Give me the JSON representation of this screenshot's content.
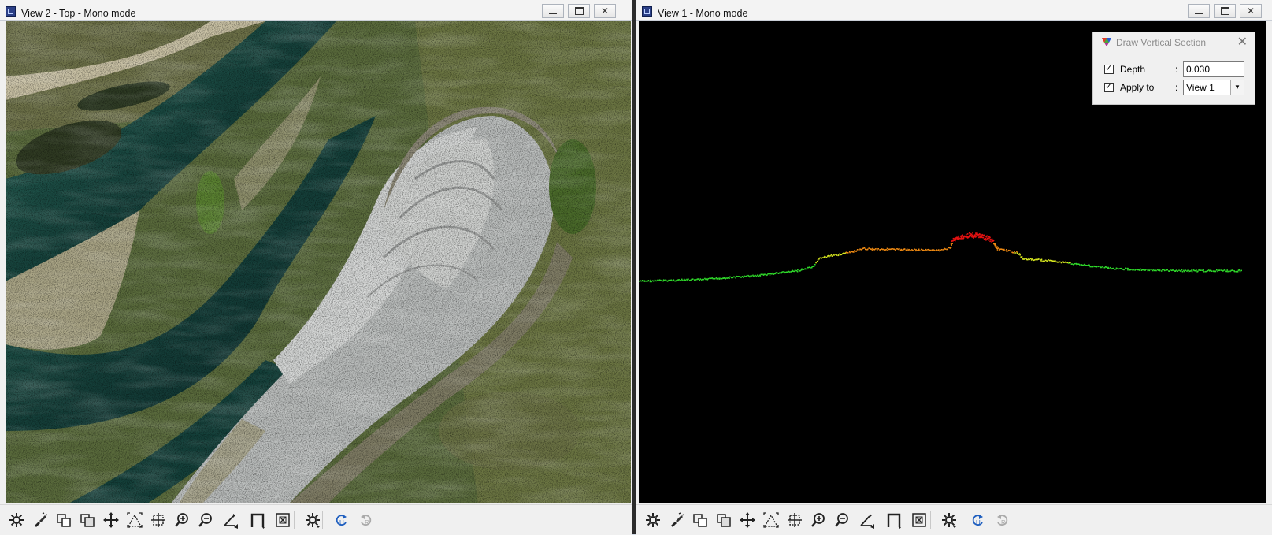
{
  "left_window": {
    "title": "View 2 - Top - Mono mode",
    "content": "aerial-orthophoto-point-cloud"
  },
  "right_window": {
    "title": "View 1 - Mono mode",
    "content": "vertical-section-profile"
  },
  "caption_buttons": {
    "minimize": "▭",
    "maximize": "⧉",
    "close": "✕"
  },
  "dialog": {
    "title": "Draw Vertical Section",
    "close": "✕",
    "depth": {
      "label": "Depth",
      "value": "0.030",
      "checked": true
    },
    "apply_to": {
      "label": "Apply to",
      "value": "View 1",
      "checked": true
    },
    "colon": ":"
  },
  "toolbar_icons": [
    "settings-icon",
    "paint-brush-icon",
    "copy-view-icon",
    "stack-views-icon",
    "pan-icon",
    "fit-view-icon",
    "zoom-window-icon",
    "zoom-in-icon",
    "zoom-out-icon",
    "rotate-axes-icon",
    "top-view-icon",
    "fit-all-icon",
    "display-settings-icon",
    "undo-view-icon",
    "redo-view-icon"
  ],
  "profile_colors": {
    "low": "#2fd92a",
    "mid": "#d8e81f",
    "high": "#f08a12",
    "peak": "#e51212"
  }
}
